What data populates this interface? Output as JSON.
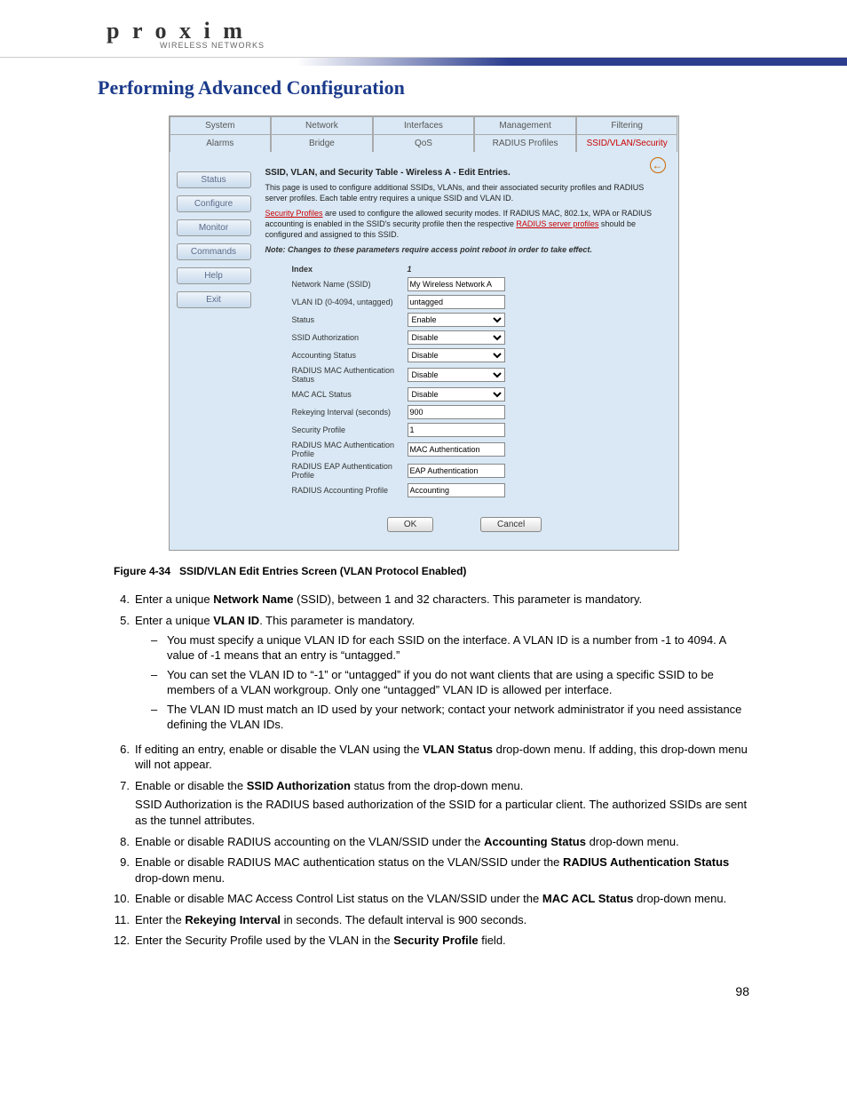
{
  "logo": {
    "brand": "p r o x i m",
    "sub": "WIRELESS NETWORKS"
  },
  "page_title": "Performing Advanced Configuration",
  "screenshot": {
    "tabs_row1": [
      "System",
      "Network",
      "Interfaces",
      "Management",
      "Filtering"
    ],
    "tabs_row2": [
      "Alarms",
      "Bridge",
      "QoS",
      "RADIUS Profiles",
      "SSID/VLAN/Security"
    ],
    "active_tab": "SSID/VLAN/Security",
    "sidebar": [
      "Status",
      "Configure",
      "Monitor",
      "Commands",
      "Help",
      "Exit"
    ],
    "heading": "SSID, VLAN, and Security Table - Wireless A - Edit Entries.",
    "p1": "This page is used to configure additional SSIDs, VLANs, and their associated security profiles and RADIUS server profiles. Each table entry requires a unique SSID and VLAN ID.",
    "p2a": "Security Profiles",
    "p2b": " are used to configure the allowed security modes. If RADIUS MAC, 802.1x, WPA or RADIUS accounting is enabled in the SSID's security profile then the respective ",
    "p2c": "RADIUS server profiles",
    "p2d": " should be configured and assigned to this SSID.",
    "note": "Note: Changes to these parameters require access point reboot in order to take effect.",
    "fields": {
      "index_label": "Index",
      "index_val": "1",
      "ssid_label": "Network Name (SSID)",
      "ssid_val": "My Wireless Network A",
      "vlan_label": "VLAN ID (0-4094, untagged)",
      "vlan_val": "untagged",
      "status_label": "Status",
      "status_val": "Enable",
      "ssidauth_label": "SSID Authorization",
      "ssidauth_val": "Disable",
      "acct_label": "Accounting Status",
      "acct_val": "Disable",
      "rmac_label": "RADIUS MAC Authentication Status",
      "rmac_val": "Disable",
      "macacl_label": "MAC ACL Status",
      "macacl_val": "Disable",
      "rekey_label": "Rekeying Interval (seconds)",
      "rekey_val": "900",
      "secprof_label": "Security Profile",
      "secprof_val": "1",
      "rmacprof_label": "RADIUS MAC Authentication Profile",
      "rmacprof_val": "MAC Authentication",
      "reapprof_label": "RADIUS EAP Authentication Profile",
      "reapprof_val": "EAP Authentication",
      "racctprof_label": "RADIUS Accounting Profile",
      "racctprof_val": "Accounting"
    },
    "ok": "OK",
    "cancel": "Cancel"
  },
  "figure": {
    "num": "Figure 4-34",
    "title": "SSID/VLAN Edit Entries Screen (VLAN Protocol Enabled)"
  },
  "steps": {
    "s4": {
      "n": "4.",
      "a": "Enter a unique ",
      "b": "Network Name",
      "c": " (SSID), between 1 and 32 characters. This parameter is mandatory."
    },
    "s5": {
      "n": "5.",
      "a": "Enter a unique ",
      "b": "VLAN ID",
      "c": ". This parameter is mandatory.",
      "d1": "You must specify a unique VLAN ID for each SSID on the interface. A VLAN ID is a number from -1 to 4094. A value of -1 means that an entry is “untagged.”",
      "d2": "You can set the VLAN ID to “-1” or “untagged” if you do not want clients that are using a specific SSID to be members of a VLAN workgroup. Only one “untagged” VLAN ID is allowed per interface.",
      "d3": "The VLAN ID must match an ID used by your network; contact your network administrator if you need assistance defining the VLAN IDs."
    },
    "s6": {
      "n": "6.",
      "a": "If editing an entry, enable or disable the VLAN using the ",
      "b": "VLAN Status",
      "c": " drop-down menu. If adding, this drop-down menu will not appear."
    },
    "s7": {
      "n": "7.",
      "a": "Enable or disable the ",
      "b": "SSID Authorization",
      "c": " status from the drop-down menu.",
      "extra": "SSID Authorization is the RADIUS based authorization of the SSID for a particular client. The authorized SSIDs are sent as the tunnel attributes."
    },
    "s8": {
      "n": "8.",
      "a": "Enable or disable RADIUS accounting on the VLAN/SSID under the ",
      "b": "Accounting Status",
      "c": " drop-down menu."
    },
    "s9": {
      "n": "9.",
      "a": "Enable or disable RADIUS MAC authentication status on the VLAN/SSID under the ",
      "b": "RADIUS Authentication Status",
      "c": " drop-down menu."
    },
    "s10": {
      "n": "10.",
      "a": "Enable or disable MAC Access Control List status on the VLAN/SSID under the ",
      "b": "MAC ACL Status",
      "c": " drop-down menu."
    },
    "s11": {
      "n": "11.",
      "a": "Enter the ",
      "b": "Rekeying Interval",
      "c": " in seconds. The default interval is 900 seconds."
    },
    "s12": {
      "n": "12.",
      "a": "Enter the Security Profile used by the VLAN in the ",
      "b": "Security Profile",
      "c": " field."
    }
  },
  "page_number": "98"
}
